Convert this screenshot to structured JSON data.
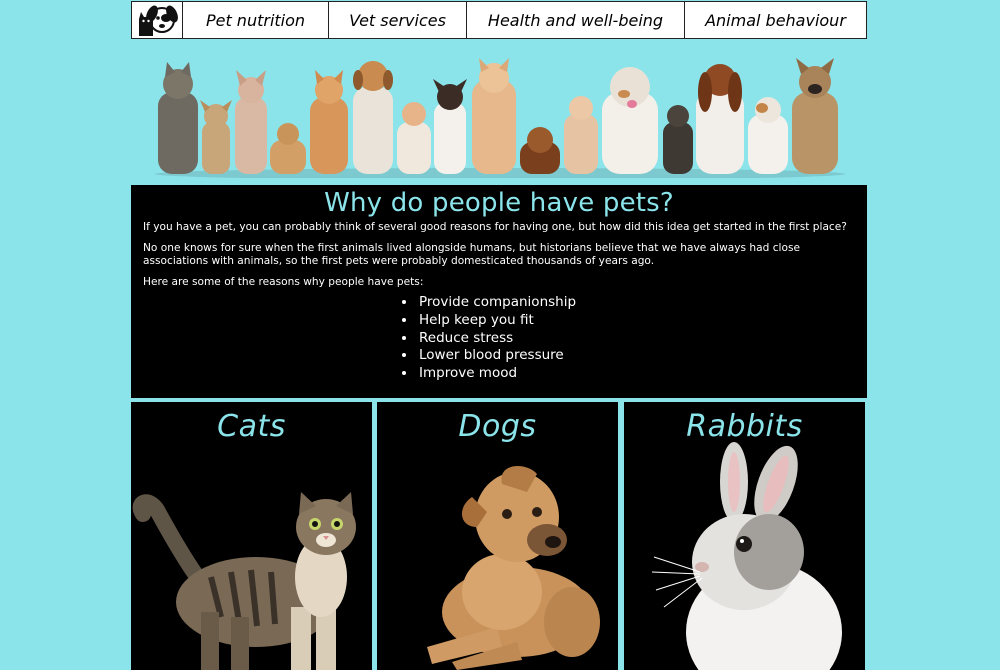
{
  "nav": {
    "logo_icon": "cat-and-dog-logo-icon",
    "items": [
      {
        "label": "Pet nutrition"
      },
      {
        "label": "Vet services"
      },
      {
        "label": "Health and well-being"
      },
      {
        "label": "Animal behaviour"
      }
    ]
  },
  "banner": {
    "image": "group-of-cats-and-dogs-photo"
  },
  "intro": {
    "title": "Why do people have pets?",
    "paragraphs": [
      "If you have a pet, you can probably think of several good reasons for having one, but how did this idea get started in the first place?",
      "No one knows for sure when the first animals lived alongside humans, but historians believe that we have always had close associations with animals, so the first pets were probably domesticated thousands of years ago.",
      "Here are some of the reasons why people have pets:"
    ],
    "reasons": [
      "Provide companionship",
      "Help keep you fit",
      "Reduce stress",
      "Lower blood pressure",
      "Improve mood"
    ]
  },
  "cards": [
    {
      "title": "Cats",
      "image": "tabby-cat-photo"
    },
    {
      "title": "Dogs",
      "image": "puppy-dog-photo"
    },
    {
      "title": "Rabbits",
      "image": "white-grey-rabbit-photo"
    }
  ],
  "colors": {
    "background": "#8ae4ea",
    "accent": "#8ae4ea",
    "panel": "#000000",
    "nav_background": "#ffffff"
  }
}
